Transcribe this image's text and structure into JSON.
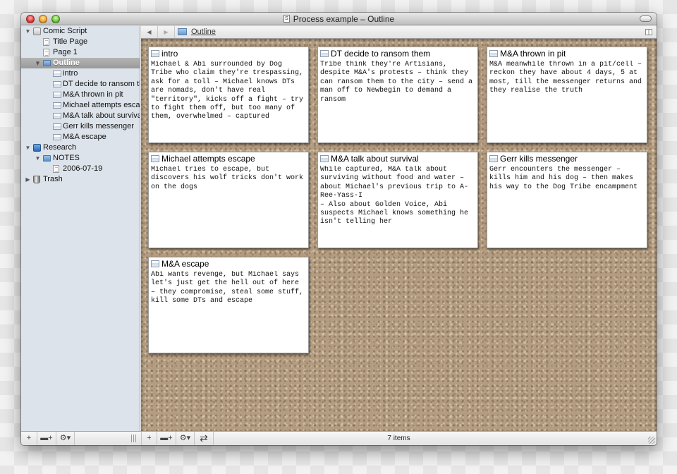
{
  "window": {
    "title": "Process example – Outline",
    "doc_icon": "script-document-icon"
  },
  "sidebar": {
    "items": [
      {
        "label": "Comic Script",
        "icon": "stack-icon",
        "level": 0,
        "expanded": true
      },
      {
        "label": "Title Page",
        "icon": "page-icon",
        "level": 1
      },
      {
        "label": "Page 1",
        "icon": "page-icon",
        "level": 1
      },
      {
        "label": "Outline",
        "icon": "folder-icon",
        "level": 1,
        "expanded": true,
        "selected": true
      },
      {
        "label": "intro",
        "icon": "index-card-icon",
        "level": 2
      },
      {
        "label": "DT decide to ransom them",
        "icon": "index-card-icon",
        "level": 2
      },
      {
        "label": "M&A thrown in pit",
        "icon": "index-card-icon",
        "level": 2
      },
      {
        "label": "Michael attempts escape",
        "icon": "index-card-icon",
        "level": 2
      },
      {
        "label": "M&A talk about survival",
        "icon": "index-card-icon",
        "level": 2
      },
      {
        "label": "Gerr kills messenger",
        "icon": "index-card-icon",
        "level": 2
      },
      {
        "label": "M&A escape",
        "icon": "index-card-icon",
        "level": 2
      },
      {
        "label": "Research",
        "icon": "research-icon",
        "level": 0,
        "expanded": true
      },
      {
        "label": "NOTES",
        "icon": "folder-icon",
        "level": 1,
        "expanded": true
      },
      {
        "label": "2006-07-19",
        "icon": "page-icon",
        "level": 2
      },
      {
        "label": "Trash",
        "icon": "trash-icon",
        "level": 0,
        "expanded": false
      }
    ]
  },
  "pathbar": {
    "back": "◀",
    "forward": "▶",
    "crumb": "Outline"
  },
  "cards": [
    {
      "title": "intro",
      "body": "Michael & Abi surrounded by Dog Tribe who claim they're trespassing, ask for a toll – Michael knows DTs are nomads, don't have real \"territory\", kicks off a fight – try to fight them off, but too many of them, overwhelmed – captured"
    },
    {
      "title": "DT decide to ransom them",
      "body": "Tribe think they're Artisians, despite M&A's protests – think they can ransom them to the city – send a man off to Newbegin to demand a ransom"
    },
    {
      "title": "M&A thrown in pit",
      "body": "M&A meanwhile thrown in a pit/cell – reckon they have about 4 days, 5 at most, till the messenger returns and they realise the truth"
    },
    {
      "title": "Michael attempts escape",
      "body": "Michael tries to escape, but discovers his wolf tricks don't work on the dogs"
    },
    {
      "title": "M&A talk about survival",
      "body": "While captured, M&A talk about surviving without food and water – about Michael's previous trip to A-Ree-Yass-I\n– Also about Golden Voice, Abi suspects Michael knows something he isn't telling her"
    },
    {
      "title": "Gerr kills messenger",
      "body": "Gerr encounters the messenger – kills him and his dog – then makes his way to the Dog Tribe encampment"
    },
    {
      "title": "M&A escape",
      "body": "Abi wants revenge, but Michael says let's just get the hell out of here – they compromise, steal some stuff, kill some DTs and escape"
    }
  ],
  "bottombar": {
    "add": "+",
    "add_folder": "▬+",
    "gear": "⚙▾",
    "swap": "⇄",
    "status": "7 items"
  }
}
